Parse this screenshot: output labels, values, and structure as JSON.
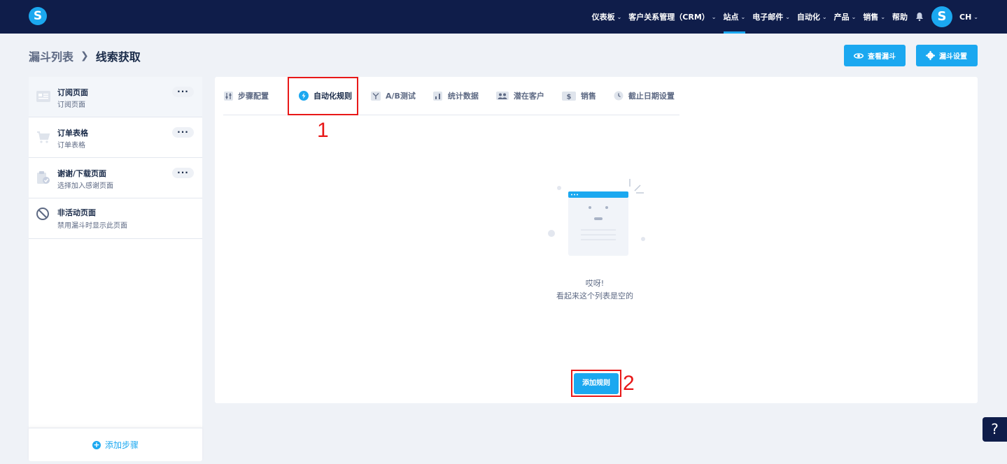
{
  "nav": {
    "items": [
      {
        "label": "仪表板",
        "chevron": true
      },
      {
        "label": "客户关系管理（CRM）",
        "chevron": true
      },
      {
        "label": "站点",
        "chevron": true,
        "active": true
      },
      {
        "label": "电子邮件",
        "chevron": true
      },
      {
        "label": "自动化",
        "chevron": true
      },
      {
        "label": "产品",
        "chevron": true
      },
      {
        "label": "销售",
        "chevron": true
      },
      {
        "label": "帮助",
        "chevron": false
      }
    ],
    "lang": "CH"
  },
  "breadcrumb": {
    "parent": "漏斗列表",
    "current": "线索获取"
  },
  "header_buttons": {
    "view": "查看漏斗",
    "settings": "漏斗设置"
  },
  "sidebar": {
    "steps": [
      {
        "title": "订阅页面",
        "subtitle": "订阅页面",
        "icon": "page-icon"
      },
      {
        "title": "订单表格",
        "subtitle": "订单表格",
        "icon": "cart-icon"
      },
      {
        "title": "谢谢/下载页面",
        "subtitle": "选择加入感谢页面",
        "icon": "clipboard-check-icon"
      },
      {
        "title": "非活动页面",
        "subtitle": "禁用漏斗时显示此页面",
        "icon": "ban-icon"
      }
    ],
    "add_step": "添加步骤"
  },
  "tabs": [
    {
      "label": "步骤配置",
      "icon": "sliders-icon"
    },
    {
      "label": "自动化规则",
      "icon": "lightning-icon",
      "active": true
    },
    {
      "label": "A/B测试",
      "icon": "split-icon"
    },
    {
      "label": "统计数据",
      "icon": "bar-chart-icon"
    },
    {
      "label": "潜在客户",
      "icon": "users-icon"
    },
    {
      "label": "销售",
      "icon": "dollar-icon"
    },
    {
      "label": "截止日期设置",
      "icon": "clock-icon"
    }
  ],
  "empty": {
    "title": "哎呀!",
    "subtitle": "看起来这个列表是空的"
  },
  "add_rule": "添加规则",
  "annotations": {
    "one": "1",
    "two": "2"
  },
  "help": "?"
}
